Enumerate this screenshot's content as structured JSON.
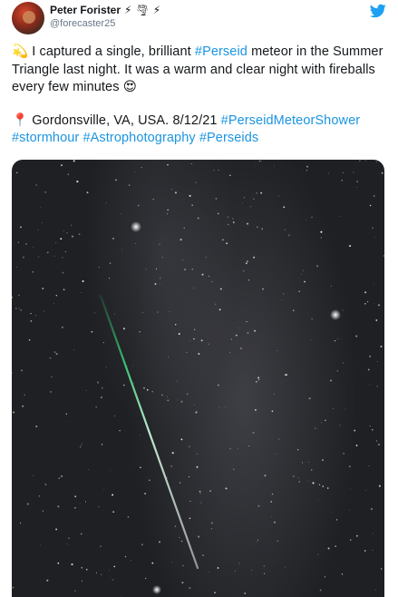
{
  "author": {
    "display_name": "Peter Forister",
    "handle": "@forecaster25",
    "name_emojis": [
      "⚡",
      "🌪",
      "⚡"
    ]
  },
  "tweet": {
    "line1_emoji": "💫",
    "line1_pre": " I captured a single, brilliant ",
    "line1_tag": "#Perseid",
    "line1_post": " meteor in the Summer Triangle last night. It was a warm and clear night with fireballs every few minutes ",
    "line1_end_emoji": "😍",
    "pin_emoji": "📍",
    "line2_text": "Gordonsville, VA, USA. 8/12/21 ",
    "hashtags": [
      "#PerseidMeteorShower",
      "#stormhour",
      "#Astrophotography",
      "#Perseids"
    ]
  },
  "colors": {
    "hashtag": "#1b95e0",
    "twitter_blue": "#1da1f2"
  },
  "icons": {
    "brand": "twitter-bird-icon"
  }
}
